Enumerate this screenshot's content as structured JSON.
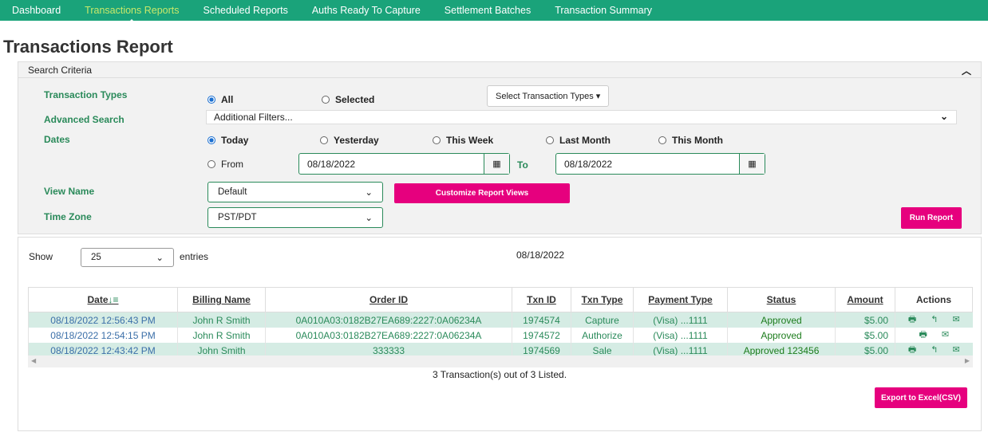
{
  "nav": {
    "items": [
      "Dashboard",
      "Transactions Reports",
      "Scheduled Reports",
      "Auths Ready To Capture",
      "Settlement Batches",
      "Transaction Summary"
    ],
    "active": 1
  },
  "page_title": "Transactions Report",
  "search": {
    "header": "Search Criteria",
    "transaction_types_label": "Transaction Types",
    "all": "All",
    "selected": "Selected",
    "select_types_button": "Select Transaction Types ▾",
    "advanced_label": "Advanced Search",
    "additional_filters": "Additional Filters...",
    "dates_label": "Dates",
    "date_options": [
      "Today",
      "Yesterday",
      "This Week",
      "Last Month",
      "This Month"
    ],
    "from": "From",
    "from_value": "08/18/2022",
    "to": "To",
    "to_value": "08/18/2022",
    "view_name_label": "View Name",
    "view_name_value": "Default",
    "customize_button": "Customize Report Views",
    "time_zone_label": "Time Zone",
    "time_zone_value": "PST/PDT",
    "run_button": "Run Report"
  },
  "results": {
    "show": "Show",
    "entries_value": "25",
    "entries": "entries",
    "date_display": "08/18/2022",
    "columns": [
      "Date",
      "Billing Name",
      "Order ID",
      "Txn ID",
      "Txn Type",
      "Payment Type",
      "Status",
      "Amount",
      "Actions"
    ],
    "rows": [
      {
        "date": "08/18/2022 12:56:43 PM",
        "name": "John R Smith",
        "order": "0A010A03:0182B27EA689:2227:0A06234A",
        "txn": "1974574",
        "type": "Capture",
        "pay": "(Visa) ...1111",
        "status": "Approved",
        "amount": "$5.00",
        "actions": [
          "print",
          "reply",
          "email"
        ]
      },
      {
        "date": "08/18/2022 12:54:15 PM",
        "name": "John R Smith",
        "order": "0A010A03:0182B27EA689:2227:0A06234A",
        "txn": "1974572",
        "type": "Authorize",
        "pay": "(Visa) ...1111",
        "status": "Approved",
        "amount": "$5.00",
        "actions": [
          "print",
          "email"
        ]
      },
      {
        "date": "08/18/2022 12:43:42 PM",
        "name": "John Smith",
        "order": "333333",
        "txn": "1974569",
        "type": "Sale",
        "pay": "(Visa) ...1111",
        "status": "Approved 123456",
        "amount": "$5.00",
        "actions": [
          "print",
          "reply",
          "email"
        ]
      }
    ],
    "summary": "3 Transaction(s) out of 3 Listed.",
    "export_button": "Export to Excel(CSV)"
  },
  "colors": {
    "nav": "#1aa37a",
    "accent": "#e6007e",
    "label": "#2a8a5a"
  }
}
